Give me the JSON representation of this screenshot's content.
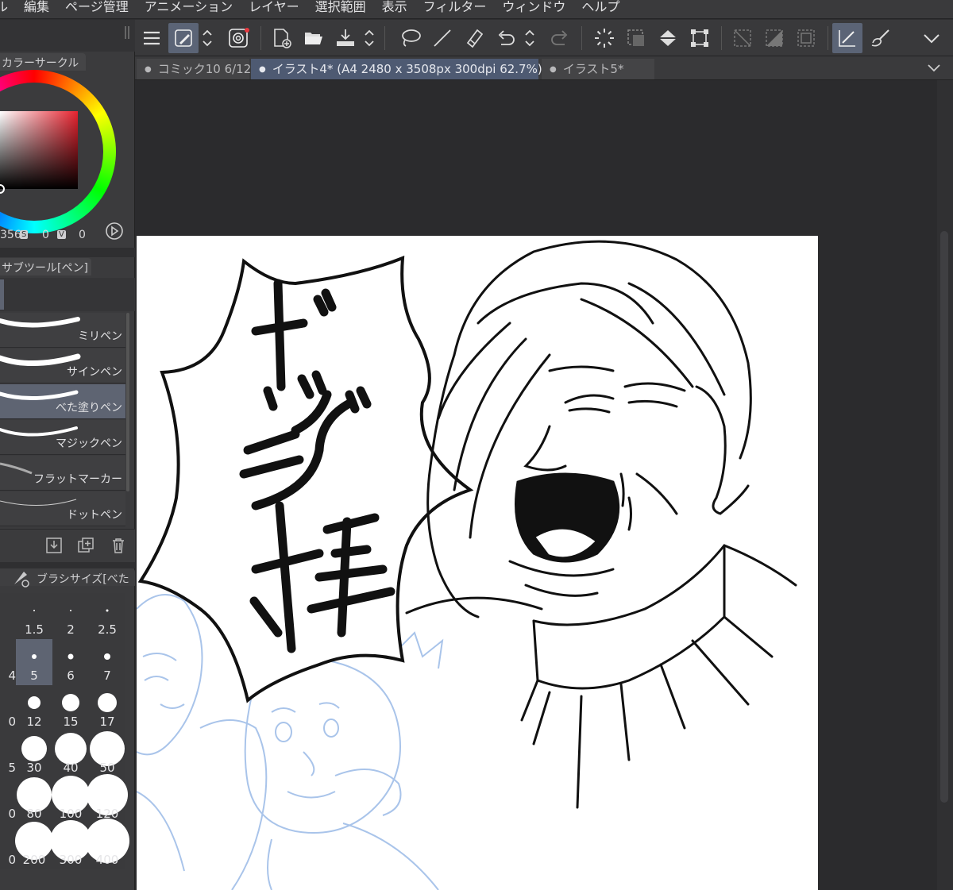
{
  "menu": [
    "ル",
    "編集",
    "ページ管理",
    "アニメーション",
    "レイヤー",
    "選択範囲",
    "表示",
    "フィルター",
    "ウィンドウ",
    "ヘルプ"
  ],
  "colorPanel": {
    "title": "カラーサークル",
    "hsv": [
      "356",
      "S",
      "0",
      "V",
      "0"
    ]
  },
  "subtool": {
    "title": "サブツール[ペン]",
    "brushes": [
      "ミリペン",
      "サインペン",
      "べた塗りペン",
      "マジックペン",
      "フラットマーカー",
      "ドットペン"
    ],
    "selected": "べた塗りペン"
  },
  "brushSize": {
    "title": "ブラシサイズ[べた",
    "rows": [
      [
        "1.5",
        "2",
        "2.5"
      ],
      [
        "5",
        "6",
        "7"
      ],
      [
        "12",
        "15",
        "17"
      ],
      [
        "30",
        "40",
        "50"
      ],
      [
        "80",
        "100",
        "120"
      ],
      [
        "200",
        "300",
        "400"
      ]
    ],
    "edgeDigits": [
      "4",
      "0",
      "5",
      "0",
      "0"
    ],
    "selected": "5"
  },
  "tabs": [
    {
      "label": "コミック10 6/12",
      "active": false
    },
    {
      "label": "イラスト4* (A4 2480 x 3508px 300dpi 62.7%)",
      "active": true
    },
    {
      "label": "イラスト5*",
      "active": false
    }
  ],
  "colors": {
    "accent": "#5b6476",
    "activeTab": "#4e5a72",
    "sketchBlue": "#a9c4ea"
  }
}
